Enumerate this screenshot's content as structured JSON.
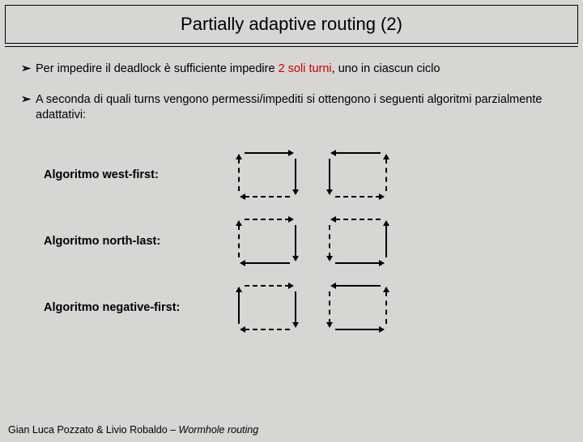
{
  "title": "Partially adaptive routing (2)",
  "bullets": [
    {
      "pre": "Per impedire il deadlock è sufficiente impedire ",
      "highlight": "2 soli turni",
      "post": ", uno in ciascun ciclo"
    },
    {
      "pre": "A seconda di quali turns vengono permessi/impediti si ottengono i seguenti algoritmi parzialmente adattativi:",
      "highlight": "",
      "post": ""
    }
  ],
  "algos": [
    {
      "label": "Algoritmo west-first:"
    },
    {
      "label": "Algoritmo north-last:"
    },
    {
      "label": "Algoritmo negative-first:"
    }
  ],
  "footer": {
    "authors": "Gian Luca Pozzato & Livio Robaldo – ",
    "work": "Wormhole routing"
  }
}
